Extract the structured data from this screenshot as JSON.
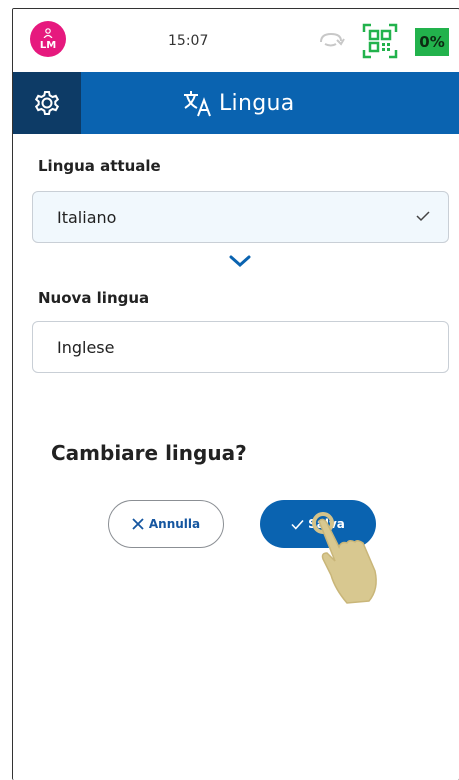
{
  "status_bar": {
    "avatar_initials": "LM",
    "time": "15:07",
    "battery": "0%",
    "icons": {
      "avatar": "user-icon",
      "sync": "sync-icon",
      "qr": "qr-code-icon"
    },
    "colors": {
      "avatar": "#e6197e",
      "battery": "#22b24c",
      "qr": "#22b24c"
    }
  },
  "header": {
    "title": "Lingua",
    "icons": {
      "settings": "gear-icon",
      "title": "translate-icon"
    },
    "colors": {
      "bar": "#0a63b0",
      "settings_bg": "#0d3b66"
    }
  },
  "form": {
    "current_label": "Lingua attuale",
    "current_value": "Italiano",
    "new_label": "Nuova lingua",
    "new_value": "Inglese",
    "question": "Cambiare lingua?"
  },
  "actions": {
    "cancel_label": "Annulla",
    "save_label": "Salva",
    "icons": {
      "cancel": "close-icon",
      "save": "check-icon",
      "pointer": "hand-pointer-icon"
    }
  }
}
